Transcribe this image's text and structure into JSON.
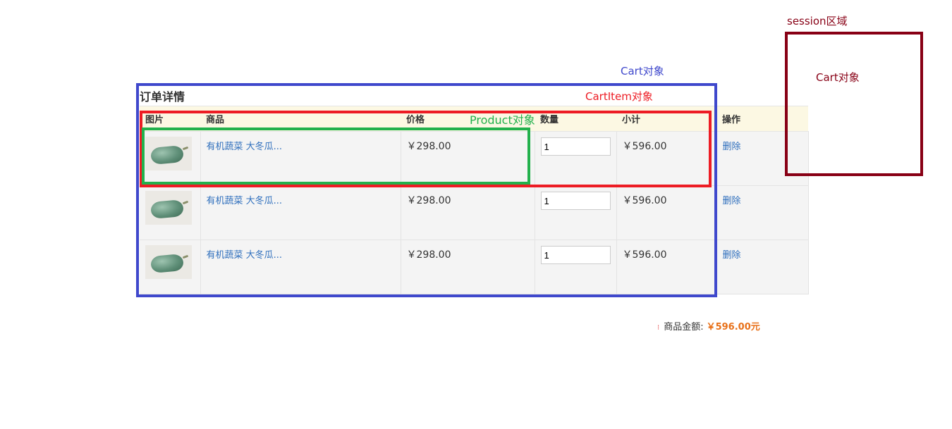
{
  "order": {
    "title": "订单详情",
    "headers": {
      "image": "图片",
      "product": "商品",
      "price": "价格",
      "quantity": "数量",
      "subtotal": "小计",
      "action": "操作"
    },
    "rows": [
      {
        "product_name": "有机蔬菜 大冬瓜...",
        "price": "￥298.00",
        "quantity": "1",
        "subtotal": "￥596.00",
        "action": "删除"
      },
      {
        "product_name": "有机蔬菜 大冬瓜...",
        "price": "￥298.00",
        "quantity": "1",
        "subtotal": "￥596.00",
        "action": "删除"
      },
      {
        "product_name": "有机蔬菜 大冬瓜...",
        "price": "￥298.00",
        "quantity": "1",
        "subtotal": "￥596.00",
        "action": "删除"
      }
    ],
    "total_label": "商品金额:",
    "total_value": "￥596.00元"
  },
  "annotations": {
    "cart_label": "Cart对象",
    "cartitem_label": "CartItem对象",
    "product_label": "Product对象",
    "session_label": "session区域",
    "session_cart_label": "Cart对象"
  },
  "colors": {
    "cart_box": "#3f48cc",
    "cartitem_box": "#ed1c24",
    "product_box": "#22b14c",
    "session_box": "#880015",
    "header_bg": "#fcf8e3",
    "row_bg": "#f4f4f4",
    "link": "#2f6fbd",
    "total_value": "#e8711a"
  }
}
